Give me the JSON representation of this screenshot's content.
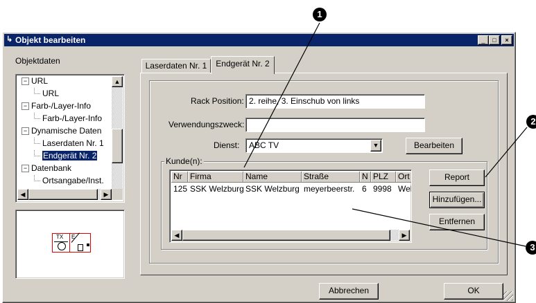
{
  "window": {
    "title": "Objekt bearbeiten",
    "controls": [
      "_",
      "□",
      "×"
    ]
  },
  "left": {
    "section_label": "Objektdaten",
    "tree": [
      {
        "label": "URL",
        "level": 0,
        "expander": "−"
      },
      {
        "label": "URL",
        "level": 1
      },
      {
        "label": "Farb-/Layer-Info",
        "level": 0,
        "expander": "−"
      },
      {
        "label": "Farb-/Layer-Info",
        "level": 1
      },
      {
        "label": "Dynamische Daten",
        "level": 0,
        "expander": "−"
      },
      {
        "label": "Laserdaten Nr. 1",
        "level": 1
      },
      {
        "label": "Endgerät Nr. 2",
        "level": 1,
        "selected": true
      },
      {
        "label": "Datenbank",
        "level": 0,
        "expander": "−"
      },
      {
        "label": "Ortsangabe/Inst.",
        "level": 1
      }
    ],
    "symbol_text_top": "TX",
    "symbol_text_right": "E"
  },
  "tabs": [
    {
      "label": "Laserdaten Nr. 1",
      "active": false
    },
    {
      "label": "Endgerät Nr. 2",
      "active": true
    }
  ],
  "form": {
    "rack_label": "Rack Position:",
    "rack_value": "2. reihe, 3. Einschub von links",
    "purpose_label": "Verwendungszweck:",
    "purpose_value": "",
    "service_label": "Dienst:",
    "service_value": "ABC TV",
    "edit_button": "Bearbeiten"
  },
  "customers": {
    "group_label": "Kunde(n):",
    "columns": [
      "Nr",
      "Firma",
      "Name",
      "Straße",
      "N",
      "PLZ",
      "Ort"
    ],
    "rows": [
      [
        "125",
        "SSK Welzburg",
        "SSK Welzburg",
        "meyerbeerstr.",
        "6",
        "9998",
        "Welz"
      ]
    ],
    "buttons": {
      "report": "Report",
      "add": "Hinzufügen...",
      "remove": "Entfernen"
    }
  },
  "footer": {
    "cancel": "Abbrechen",
    "ok": "OK"
  },
  "callouts": [
    "1",
    "2",
    "3"
  ],
  "colors": {
    "titlebar": "#0a246a",
    "selection": "#0a246a",
    "face": "#d4d0c8",
    "symbol_red": "#e00000"
  }
}
